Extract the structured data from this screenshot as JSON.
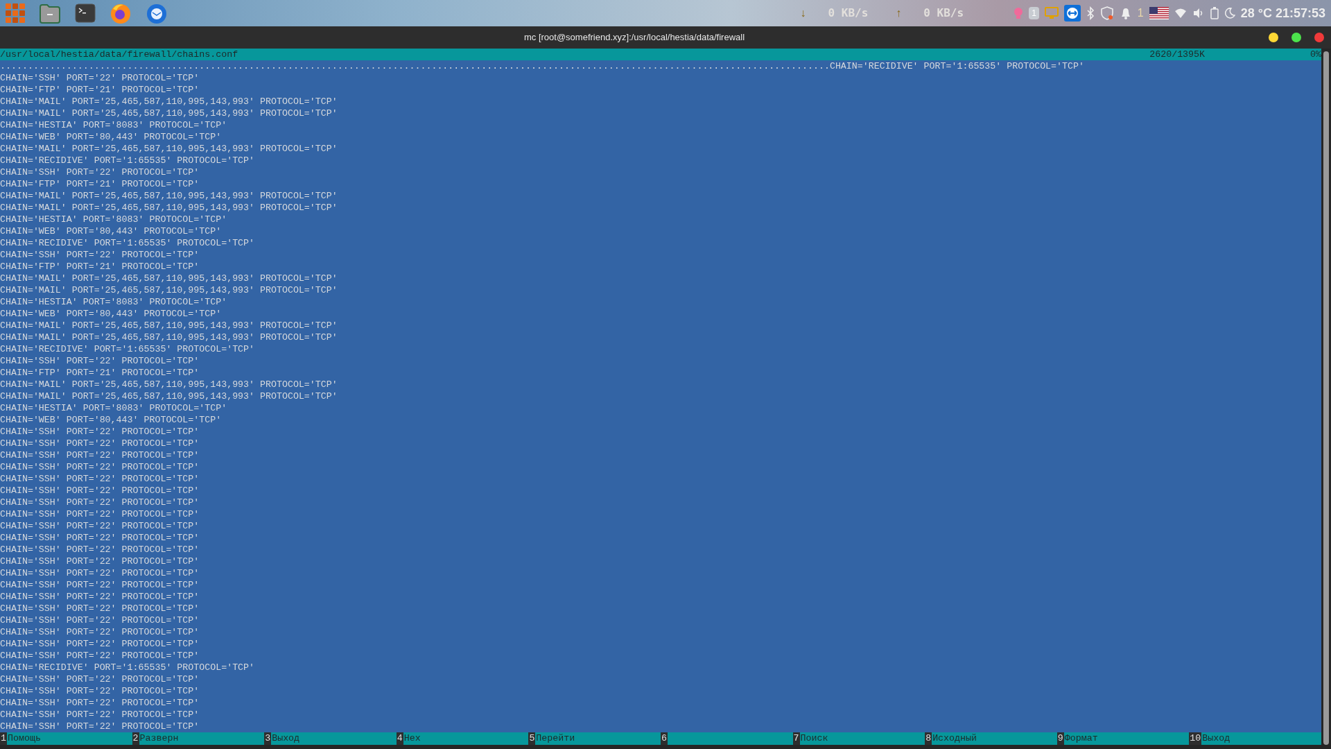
{
  "taskbar": {
    "apps": [
      {
        "kind": "grid"
      },
      {
        "kind": "files"
      },
      {
        "kind": "terminal"
      },
      {
        "kind": "browser"
      },
      {
        "kind": "mail"
      }
    ],
    "net": [
      {
        "arrow": "↓",
        "speed": "0 KB/s"
      },
      {
        "arrow": "↑",
        "speed": "0 KB/s"
      }
    ],
    "tray_badges": [
      "1",
      "1"
    ],
    "clock": "28 °C 21:57:53"
  },
  "window": {
    "title": "mc [root@somefriend.xyz]:/usr/local/hestia/data/firewall"
  },
  "viewer": {
    "path": "/usr/local/hestia/data/firewall/chains.conf",
    "position": "2620/1395K",
    "percent": "0%",
    "lines": [
      "......................................................................................................................................................CHAIN='RECIDIVE' PORT='1:65535' PROTOCOL='TCP'",
      "CHAIN='SSH' PORT='22' PROTOCOL='TCP'",
      "CHAIN='FTP' PORT='21' PROTOCOL='TCP'",
      "CHAIN='MAIL' PORT='25,465,587,110,995,143,993' PROTOCOL='TCP'",
      "CHAIN='MAIL' PORT='25,465,587,110,995,143,993' PROTOCOL='TCP'",
      "CHAIN='HESTIA' PORT='8083' PROTOCOL='TCP'",
      "CHAIN='WEB' PORT='80,443' PROTOCOL='TCP'",
      "CHAIN='MAIL' PORT='25,465,587,110,995,143,993' PROTOCOL='TCP'",
      "CHAIN='RECIDIVE' PORT='1:65535' PROTOCOL='TCP'",
      "CHAIN='SSH' PORT='22' PROTOCOL='TCP'",
      "CHAIN='FTP' PORT='21' PROTOCOL='TCP'",
      "CHAIN='MAIL' PORT='25,465,587,110,995,143,993' PROTOCOL='TCP'",
      "CHAIN='MAIL' PORT='25,465,587,110,995,143,993' PROTOCOL='TCP'",
      "CHAIN='HESTIA' PORT='8083' PROTOCOL='TCP'",
      "CHAIN='WEB' PORT='80,443' PROTOCOL='TCP'",
      "CHAIN='RECIDIVE' PORT='1:65535' PROTOCOL='TCP'",
      "CHAIN='SSH' PORT='22' PROTOCOL='TCP'",
      "CHAIN='FTP' PORT='21' PROTOCOL='TCP'",
      "CHAIN='MAIL' PORT='25,465,587,110,995,143,993' PROTOCOL='TCP'",
      "CHAIN='MAIL' PORT='25,465,587,110,995,143,993' PROTOCOL='TCP'",
      "CHAIN='HESTIA' PORT='8083' PROTOCOL='TCP'",
      "CHAIN='WEB' PORT='80,443' PROTOCOL='TCP'",
      "CHAIN='MAIL' PORT='25,465,587,110,995,143,993' PROTOCOL='TCP'",
      "CHAIN='MAIL' PORT='25,465,587,110,995,143,993' PROTOCOL='TCP'",
      "CHAIN='RECIDIVE' PORT='1:65535' PROTOCOL='TCP'",
      "CHAIN='SSH' PORT='22' PROTOCOL='TCP'",
      "CHAIN='FTP' PORT='21' PROTOCOL='TCP'",
      "CHAIN='MAIL' PORT='25,465,587,110,995,143,993' PROTOCOL='TCP'",
      "CHAIN='MAIL' PORT='25,465,587,110,995,143,993' PROTOCOL='TCP'",
      "CHAIN='HESTIA' PORT='8083' PROTOCOL='TCP'",
      "CHAIN='WEB' PORT='80,443' PROTOCOL='TCP'",
      "CHAIN='SSH' PORT='22' PROTOCOL='TCP'",
      "CHAIN='SSH' PORT='22' PROTOCOL='TCP'",
      "CHAIN='SSH' PORT='22' PROTOCOL='TCP'",
      "CHAIN='SSH' PORT='22' PROTOCOL='TCP'",
      "CHAIN='SSH' PORT='22' PROTOCOL='TCP'",
      "CHAIN='SSH' PORT='22' PROTOCOL='TCP'",
      "CHAIN='SSH' PORT='22' PROTOCOL='TCP'",
      "CHAIN='SSH' PORT='22' PROTOCOL='TCP'",
      "CHAIN='SSH' PORT='22' PROTOCOL='TCP'",
      "CHAIN='SSH' PORT='22' PROTOCOL='TCP'",
      "CHAIN='SSH' PORT='22' PROTOCOL='TCP'",
      "CHAIN='SSH' PORT='22' PROTOCOL='TCP'",
      "CHAIN='SSH' PORT='22' PROTOCOL='TCP'",
      "CHAIN='SSH' PORT='22' PROTOCOL='TCP'",
      "CHAIN='SSH' PORT='22' PROTOCOL='TCP'",
      "CHAIN='SSH' PORT='22' PROTOCOL='TCP'",
      "CHAIN='SSH' PORT='22' PROTOCOL='TCP'",
      "CHAIN='SSH' PORT='22' PROTOCOL='TCP'",
      "CHAIN='SSH' PORT='22' PROTOCOL='TCP'",
      "CHAIN='SSH' PORT='22' PROTOCOL='TCP'",
      "CHAIN='RECIDIVE' PORT='1:65535' PROTOCOL='TCP'",
      "CHAIN='SSH' PORT='22' PROTOCOL='TCP'",
      "CHAIN='SSH' PORT='22' PROTOCOL='TCP'",
      "CHAIN='SSH' PORT='22' PROTOCOL='TCP'",
      "CHAIN='SSH' PORT='22' PROTOCOL='TCP'",
      "CHAIN='SSH' PORT='22' PROTOCOL='TCP'"
    ]
  },
  "function_keys": [
    {
      "number": "1",
      "label": "Помощь"
    },
    {
      "number": "2",
      "label": "Разверн"
    },
    {
      "number": "3",
      "label": "Выход"
    },
    {
      "number": "4",
      "label": "Hex"
    },
    {
      "number": "5",
      "label": "Перейти"
    },
    {
      "number": "6"
    },
    {
      "number": "7",
      "label": "Поиск"
    },
    {
      "number": "8",
      "label": "Исходный"
    },
    {
      "number": "9",
      "label": "Формат"
    },
    {
      "number": "10",
      "label": "Выход"
    }
  ]
}
